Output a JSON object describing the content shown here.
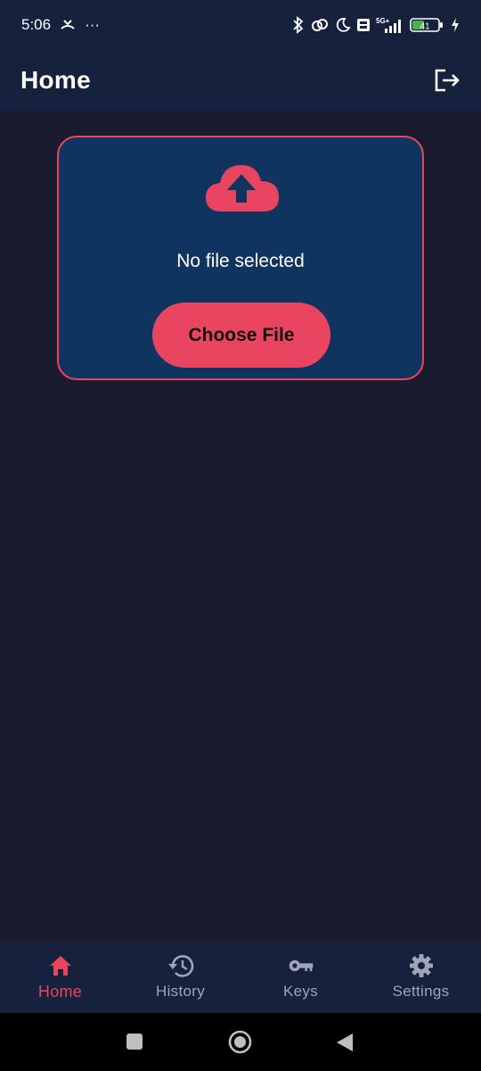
{
  "status_bar": {
    "time": "5:06",
    "dots": "···",
    "battery_level": "41",
    "network": "5G+"
  },
  "app_bar": {
    "title": "Home",
    "logout_icon": "logout-icon"
  },
  "upload_card": {
    "icon": "cloud-upload-icon",
    "file_status": "No file selected",
    "choose_button_label": "Choose File"
  },
  "bottom_nav": {
    "items": [
      {
        "label": "Home",
        "icon": "home-icon",
        "active": true
      },
      {
        "label": "History",
        "icon": "history-icon",
        "active": false
      },
      {
        "label": "Keys",
        "icon": "key-icon",
        "active": false
      },
      {
        "label": "Settings",
        "icon": "gear-icon",
        "active": false
      }
    ]
  },
  "colors": {
    "background": "#1b1b2f",
    "bar": "#16213e",
    "card": "#0f3460",
    "accent": "#e94560",
    "inactive": "#a0a4b8"
  }
}
